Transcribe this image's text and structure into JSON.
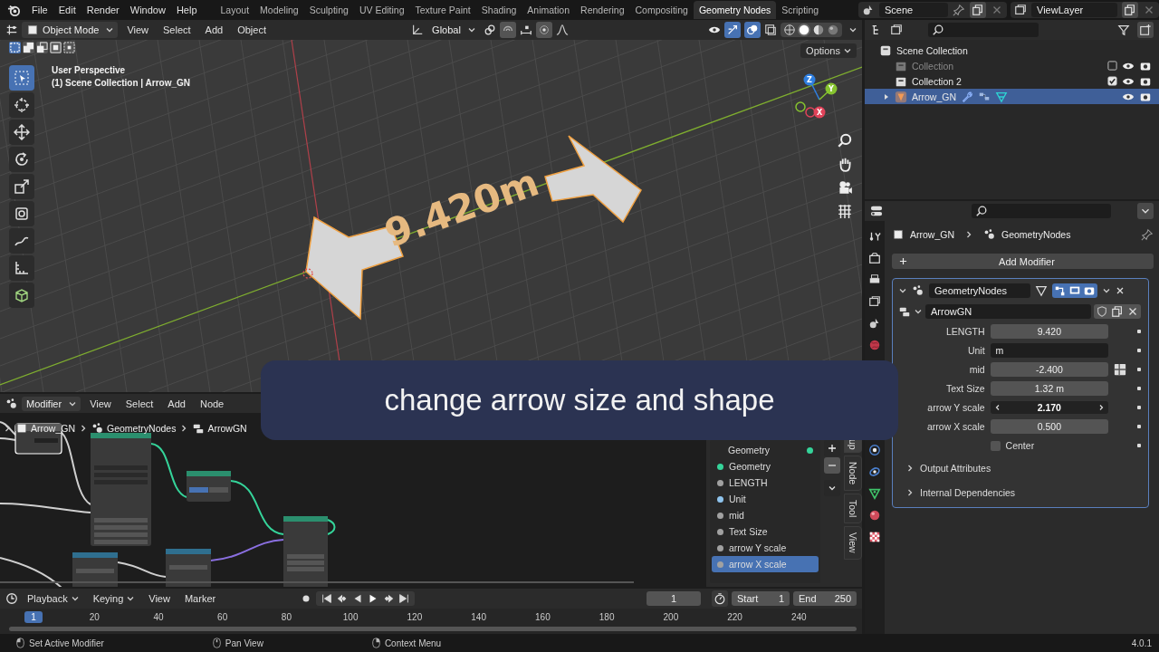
{
  "topbar": {
    "menus": [
      "File",
      "Edit",
      "Render",
      "Window",
      "Help"
    ],
    "workspaces": [
      {
        "label": "Layout",
        "selected": false
      },
      {
        "label": "Modeling",
        "selected": false
      },
      {
        "label": "Sculpting",
        "selected": false
      },
      {
        "label": "UV Editing",
        "selected": false
      },
      {
        "label": "Texture Paint",
        "selected": false
      },
      {
        "label": "Shading",
        "selected": false
      },
      {
        "label": "Animation",
        "selected": false
      },
      {
        "label": "Rendering",
        "selected": false
      },
      {
        "label": "Compositing",
        "selected": false
      },
      {
        "label": "Geometry Nodes",
        "selected": true
      },
      {
        "label": "Scripting",
        "selected": false
      }
    ],
    "scene": "Scene",
    "view_layer": "ViewLayer"
  },
  "viewport": {
    "mode": "Object Mode",
    "menus": [
      "View",
      "Select",
      "Add",
      "Object"
    ],
    "orientation": "Global",
    "options": "Options",
    "perspective": "User Perspective",
    "context": "(1) Scene Collection | Arrow_GN",
    "dimension_text": "9.420m",
    "shading": [
      {
        "kind": "wireframe",
        "selected": false
      },
      {
        "kind": "solid",
        "selected": true
      },
      {
        "kind": "material",
        "selected": false
      },
      {
        "kind": "rendered",
        "selected": false
      }
    ],
    "gizmo": [
      {
        "axis": "Z",
        "color": "#2f7fe0"
      },
      {
        "axis": "Y",
        "color": "#86c32f"
      },
      {
        "axis": "X",
        "color": "#e0435a"
      }
    ],
    "tools": [
      {
        "kind": "select",
        "selected": true
      },
      {
        "kind": "cursor",
        "selected": false
      },
      {
        "kind": "move",
        "selected": false
      },
      {
        "kind": "rotate",
        "selected": false
      },
      {
        "kind": "scale",
        "selected": false
      },
      {
        "kind": "transform",
        "selected": false
      },
      {
        "kind": "annotate",
        "selected": false
      },
      {
        "kind": "measure",
        "selected": false
      },
      {
        "kind": "add-cube",
        "selected": false
      }
    ]
  },
  "outliner": {
    "items": [
      {
        "name": "Scene Collection",
        "kind": "scene",
        "selected": false,
        "children": [
          {
            "name": "Collection",
            "kind": "collection",
            "checked": false,
            "selected": false
          },
          {
            "name": "Collection 2",
            "kind": "collection",
            "checked": true,
            "selected": false
          },
          {
            "name": "Arrow_GN",
            "kind": "object",
            "expanded": false,
            "selected": true
          }
        ]
      }
    ]
  },
  "properties": {
    "object": "Arrow_GN",
    "modifier_path": "GeometryNodes",
    "add_modifier": "Add Modifier",
    "modifier": {
      "name": "GeometryNodes",
      "expanded": true,
      "node_group": "ArrowGN",
      "params": [
        {
          "label": "LENGTH",
          "value": "9.420",
          "kind": "number"
        },
        {
          "label": "Unit",
          "value": "m",
          "kind": "text"
        },
        {
          "label": "mid",
          "value": "-2.400",
          "kind": "number",
          "attribute_toggle": true
        },
        {
          "label": "Text Size",
          "value": "1.32 m",
          "kind": "number"
        },
        {
          "label": "arrow Y scale",
          "value": "2.170",
          "kind": "stepper"
        },
        {
          "label": "arrow X scale",
          "value": "0.500",
          "kind": "number"
        },
        {
          "label": "Center",
          "kind": "checkbox",
          "checked": false
        }
      ],
      "panels": [
        {
          "label": "Output Attributes",
          "expanded": false
        },
        {
          "label": "Internal Dependencies",
          "expanded": false
        }
      ]
    }
  },
  "node_editor": {
    "mode": "Modifier",
    "menus": [
      "View",
      "Select",
      "Add",
      "Node"
    ],
    "breadcrumb": [
      "Arrow_GN",
      "GeometryNodes",
      "ArrowGN"
    ],
    "interface": [
      {
        "name": "Geometry",
        "kind": "output",
        "color": "#35d49a",
        "selected": false
      },
      {
        "name": "Geometry",
        "kind": "input",
        "color": "#35d49a",
        "selected": false
      },
      {
        "name": "LENGTH",
        "kind": "input",
        "color": "#a1a1a1",
        "selected": false
      },
      {
        "name": "Unit",
        "kind": "input",
        "color": "#8fc4ee",
        "selected": false
      },
      {
        "name": "mid",
        "kind": "input",
        "color": "#a1a1a1",
        "selected": false
      },
      {
        "name": "Text Size",
        "kind": "input",
        "color": "#a1a1a1",
        "selected": false
      },
      {
        "name": "arrow Y scale",
        "kind": "input",
        "color": "#a1a1a1",
        "selected": false
      },
      {
        "name": "arrow X scale",
        "kind": "input",
        "color": "#a1a1a1",
        "selected": true
      }
    ],
    "tabs": [
      {
        "label": "up",
        "selected": true
      },
      {
        "label": "Node",
        "selected": false
      },
      {
        "label": "Tool",
        "selected": false
      },
      {
        "label": "View",
        "selected": false
      }
    ]
  },
  "caption": "change arrow size and shape",
  "timeline": {
    "menus": [
      {
        "label": "Playback",
        "dropdown": true
      },
      {
        "label": "Keying",
        "dropdown": true
      },
      {
        "label": "View",
        "dropdown": false
      },
      {
        "label": "Marker",
        "dropdown": false
      }
    ],
    "current_frame": "1",
    "start_label": "Start",
    "start": "1",
    "end_label": "End",
    "end": "250",
    "playhead": "1",
    "ruler": [
      "20",
      "40",
      "60",
      "80",
      "100",
      "120",
      "140",
      "160",
      "180",
      "200",
      "220",
      "240"
    ]
  },
  "status_bar": {
    "hints": [
      {
        "text": "Set Active Modifier",
        "kind": "left"
      },
      {
        "text": "Pan View",
        "kind": "middle"
      },
      {
        "text": "Context Menu",
        "kind": "right"
      }
    ],
    "version": "4.0.1"
  }
}
